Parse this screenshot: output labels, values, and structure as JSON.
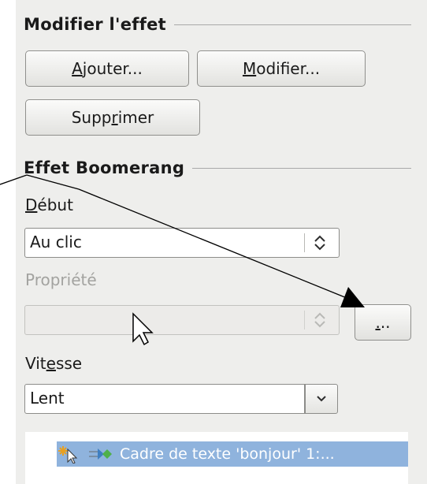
{
  "modify_section": {
    "title": "Modifier l'effet",
    "add_button": {
      "pre": "",
      "key": "A",
      "post": "jouter..."
    },
    "modify_button": {
      "pre": "",
      "key": "M",
      "post": "odifier..."
    },
    "delete_button": {
      "pre": "Supp",
      "key": "r",
      "post": "imer"
    }
  },
  "effect_section": {
    "title": "Effet Boomerang",
    "start_label": {
      "pre": "",
      "key": "D",
      "post": "ébut"
    },
    "start_value": "Au clic",
    "property_label": "Propriété",
    "property_value": "",
    "property_options_button": {
      "pre": "",
      "key": ".",
      "post": ".."
    },
    "speed_label": {
      "pre": "Vit",
      "key": "e",
      "post": "sse"
    },
    "speed_value": "Lent"
  },
  "effects_list": {
    "items": [
      {
        "text": "Cadre de texte 'bonjour' 1:...",
        "selected": true,
        "icons": [
          "on-click-icon",
          "effect-arrow-icon"
        ]
      }
    ]
  },
  "annotation": {
    "arrow_color": "#000000"
  },
  "colors": {
    "panel": "#eeeeec",
    "selection": "#8fb3dd",
    "disabled_text": "#a3a3a0"
  }
}
